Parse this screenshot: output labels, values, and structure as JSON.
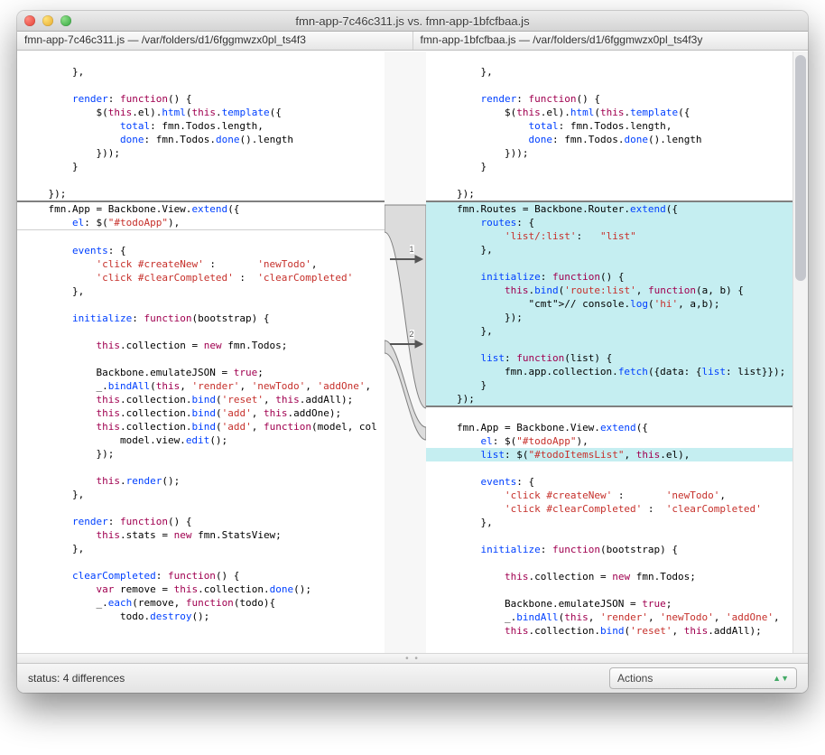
{
  "window": {
    "title": "fmn-app-7c46c311.js vs. fmn-app-1bfcfbaa.js",
    "left_path": "fmn-app-7c46c311.js — /var/folders/d1/6fggmwzx0pl_ts4f3",
    "right_path": "fmn-app-1bfcfbaa.js — /var/folders/d1/6fggmwzx0pl_ts4f3y"
  },
  "status": {
    "label": "status:",
    "value": "4 differences"
  },
  "actions_menu": {
    "label": "Actions"
  },
  "gutter": {
    "marker1": "1",
    "marker2": "2"
  },
  "left_code": {
    "common_top": [
      "        },",
      "",
      "        render: function() {",
      "            $(this.el).html(this.template({",
      "                total: fmn.Todos.length,",
      "                done: fmn.Todos.done().length",
      "            }));",
      "        }",
      "",
      "    });"
    ],
    "diff_region": [
      "    fmn.App = Backbone.View.extend({",
      "        el: $(\"#todoApp\"),",
      "",
      "        events: {",
      "            'click #createNew' :       'newTodo',",
      "            'click #clearCompleted' :  'clearCompleted'",
      "        },",
      "",
      "        initialize: function(bootstrap) {",
      "",
      "            this.collection = new fmn.Todos;",
      "",
      "            Backbone.emulateJSON = true;",
      "            _.bindAll(this, 'render', 'newTodo', 'addOne',",
      "            this.collection.bind('reset', this.addAll);",
      "            this.collection.bind('add', this.addOne);",
      "            this.collection.bind('add', function(model, col",
      "                model.view.edit();",
      "            });",
      "",
      "            this.render();",
      "        },",
      "",
      "        render: function() {",
      "            this.stats = new fmn.StatsView;",
      "        },",
      "",
      "        clearCompleted: function() {",
      "            var remove = this.collection.done();",
      "            _.each(remove, function(todo){",
      "                todo.destroy();"
    ]
  },
  "right_code": {
    "common_top": [
      "        },",
      "",
      "        render: function() {",
      "            $(this.el).html(this.template({",
      "                total: fmn.Todos.length,",
      "                done: fmn.Todos.done().length",
      "            }));",
      "        }",
      "",
      "    });"
    ],
    "added_block": [
      "    fmn.Routes = Backbone.Router.extend({",
      "        routes: {",
      "            'list/:list':   \"list\"",
      "        },",
      "",
      "        initialize: function() {",
      "            this.bind('route:list', function(a, b) {",
      "                // console.log('hi', a,b);",
      "            });",
      "        },",
      "",
      "        list: function(list) {",
      "            fmn.app.collection.fetch({data: {list: list}});",
      "        }",
      "    });"
    ],
    "after_block": [
      "",
      "    fmn.App = Backbone.View.extend({",
      "        el: $(\"#todoApp\"),"
    ],
    "added_line": "        list: $(\"#todoItemsList\", this.el),",
    "tail": [
      "",
      "        events: {",
      "            'click #createNew' :       'newTodo',",
      "            'click #clearCompleted' :  'clearCompleted'",
      "        },",
      "",
      "        initialize: function(bootstrap) {",
      "",
      "            this.collection = new fmn.Todos;",
      "",
      "            Backbone.emulateJSON = true;",
      "            _.bindAll(this, 'render', 'newTodo', 'addOne',",
      "            this.collection.bind('reset', this.addAll);"
    ]
  }
}
